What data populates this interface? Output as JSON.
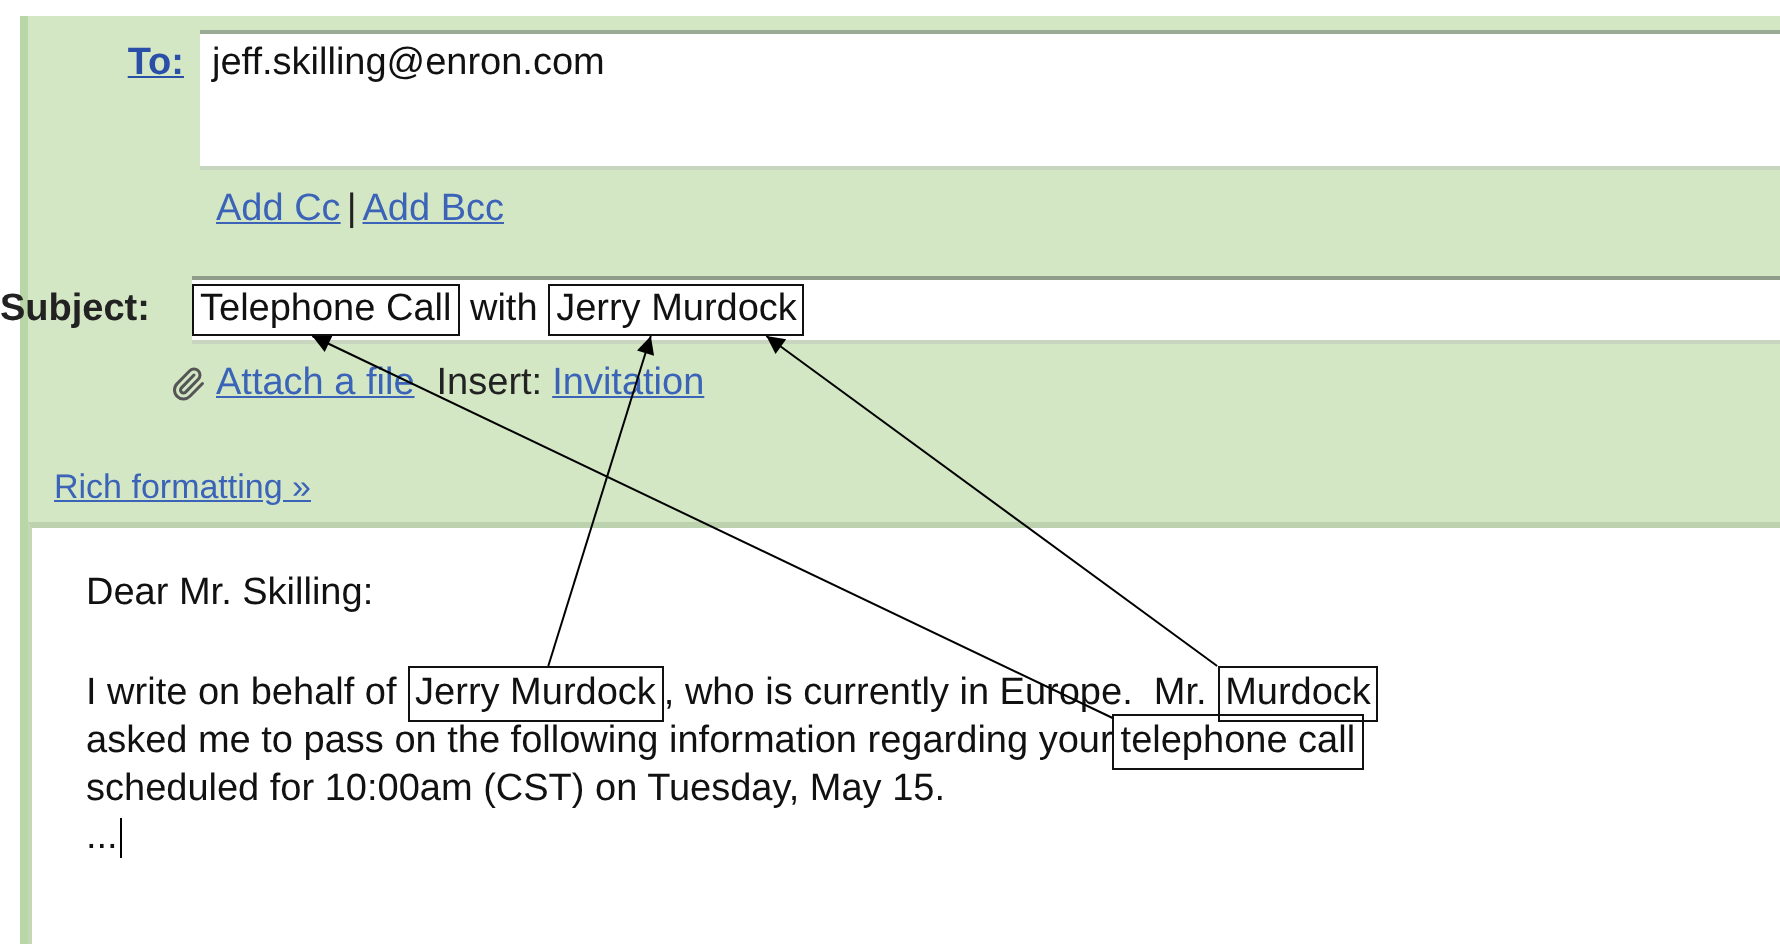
{
  "to": {
    "label": "To:",
    "value": "jeff.skilling@enron.com"
  },
  "cc_links": [
    "Add Cc",
    "Add Bcc"
  ],
  "cc_separator": "|",
  "subject": {
    "label": "Subject:",
    "segments": [
      {
        "text": "Telephone Call",
        "boxed": true
      },
      {
        "text": " with ",
        "boxed": false
      },
      {
        "text": "Jerry Murdock",
        "boxed": true
      }
    ]
  },
  "attach": {
    "link": "Attach a file",
    "insert_label": "Insert:",
    "insert_link": "Invitation"
  },
  "rich_formatting": "Rich formatting »",
  "body": {
    "lines": [
      [
        {
          "text": "Dear Mr. Skilling:",
          "boxed": false
        }
      ],
      [
        {
          "text": "I write on behalf of ",
          "boxed": false
        },
        {
          "text": "Jerry Murdock",
          "boxed": true
        },
        {
          "text": ", who is currently in Europe.  Mr. ",
          "boxed": false
        },
        {
          "text": "Murdock",
          "boxed": true
        }
      ],
      [
        {
          "text": "asked me to pass on the following information regarding your",
          "boxed": false
        },
        {
          "text": "telephone call",
          "boxed": true
        }
      ],
      [
        {
          "text": "scheduled for 10:00am (CST) on Tuesday, May 15.",
          "boxed": false
        }
      ],
      [
        {
          "text": "...",
          "boxed": false
        }
      ]
    ],
    "caret": true
  }
}
